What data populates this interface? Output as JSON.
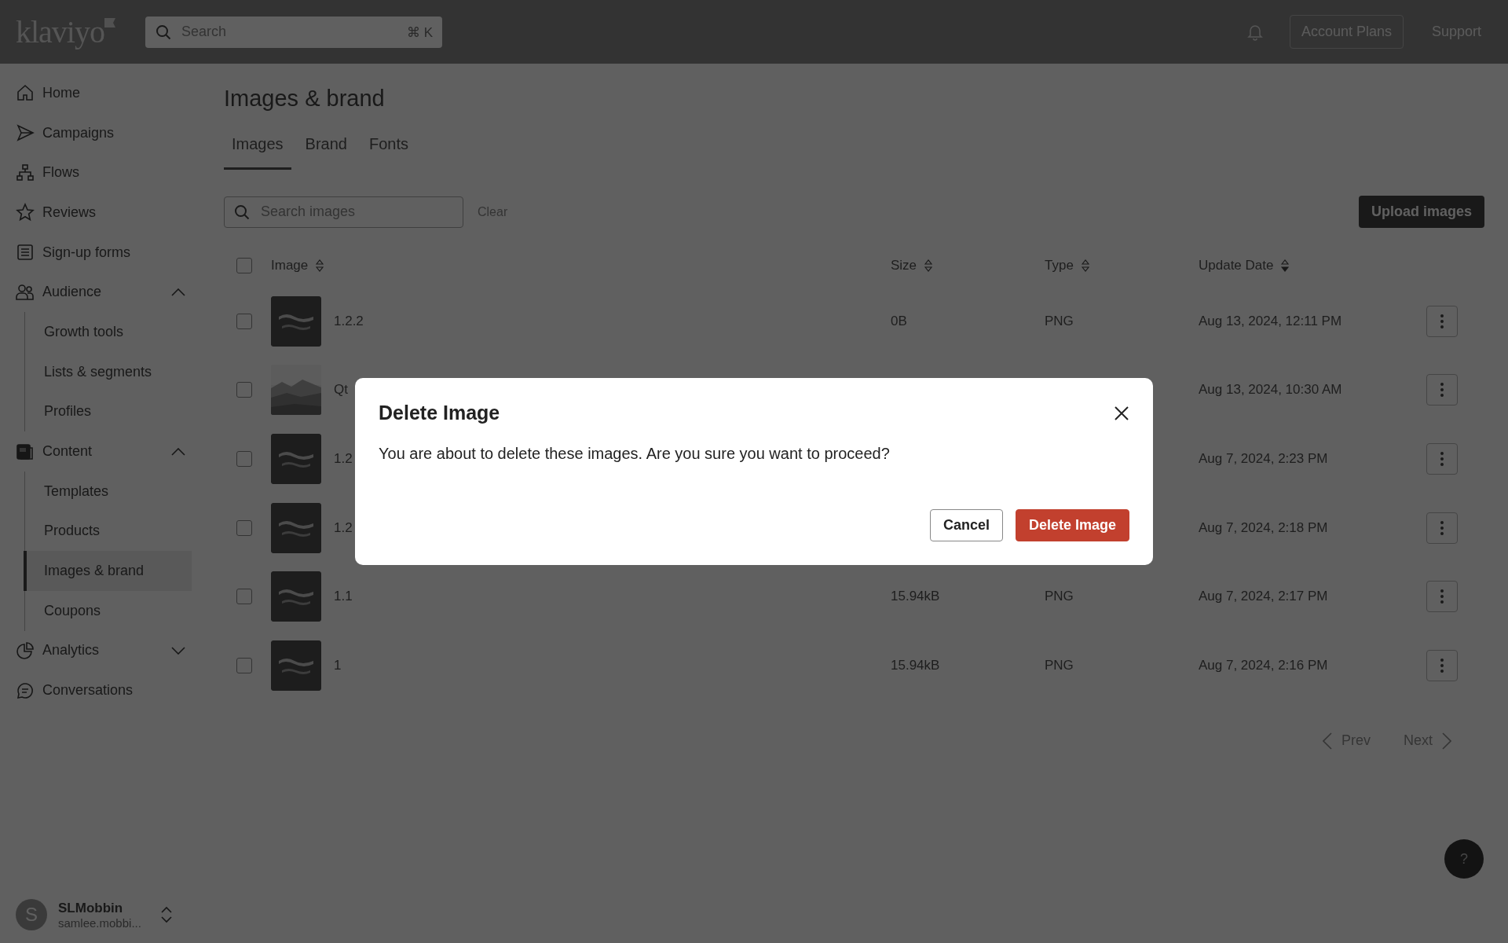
{
  "topbar": {
    "logo": "klaviyo",
    "search": {
      "placeholder": "Search",
      "shortcut": "⌘ K"
    },
    "buttons": [
      "Account Plans",
      "Support"
    ]
  },
  "sidebar": {
    "items": [
      {
        "label": "Home",
        "selected": false
      },
      {
        "label": "Campaigns",
        "selected": false
      },
      {
        "label": "Flows",
        "selected": false
      },
      {
        "label": "Reviews",
        "selected": false
      },
      {
        "label": "Sign-up forms",
        "selected": false
      },
      {
        "label": "Audience",
        "selected": false,
        "expanded": true,
        "children": [
          {
            "label": "Growth tools",
            "selected": false
          },
          {
            "label": "Lists & segments",
            "selected": false
          },
          {
            "label": "Profiles",
            "selected": false
          }
        ]
      },
      {
        "label": "Content",
        "selected": false,
        "expanded": true,
        "children": [
          {
            "label": "Templates",
            "selected": false
          },
          {
            "label": "Products",
            "selected": false
          },
          {
            "label": "Images & brand",
            "selected": true
          },
          {
            "label": "Coupons",
            "selected": false
          }
        ]
      },
      {
        "label": "Analytics",
        "selected": false,
        "expanded": false
      },
      {
        "label": "Conversations",
        "selected": false
      }
    ],
    "user": {
      "initial": "S",
      "name": "SLMobbin",
      "email": "samlee.mobbi..."
    }
  },
  "page": {
    "title": "Images & brand",
    "tabs": [
      {
        "label": "Images",
        "selected": true
      },
      {
        "label": "Brand",
        "selected": false
      },
      {
        "label": "Fonts",
        "selected": false
      }
    ],
    "search": {
      "placeholder": "Search images"
    },
    "clear": "Clear",
    "upload": "Upload images"
  },
  "table": {
    "select_all": {
      "checked": false
    },
    "columns": [
      {
        "label": "Image",
        "sorted": false
      },
      {
        "label": "Size",
        "sorted": false
      },
      {
        "label": "Type",
        "sorted": false
      },
      {
        "label": "Update Date",
        "sorted": true
      }
    ],
    "rows": [
      {
        "checked": false,
        "name": "1.2.2",
        "size": "0B",
        "type": "PNG",
        "date": "Aug 13, 2024, 12:11 PM"
      },
      {
        "checked": false,
        "name": "Qt",
        "date": "Aug 13, 2024, 10:30 AM"
      },
      {
        "checked": false,
        "name": "1.2",
        "date": "Aug 7, 2024, 2:23 PM"
      },
      {
        "checked": false,
        "name": "1.2",
        "date": "Aug 7, 2024, 2:18 PM"
      },
      {
        "checked": false,
        "name": "1.1",
        "size": "15.94kB",
        "type": "PNG",
        "date": "Aug 7, 2024, 2:17 PM"
      },
      {
        "checked": false,
        "name": "1",
        "size": "15.94kB",
        "type": "PNG",
        "date": "Aug 7, 2024, 2:16 PM"
      }
    ]
  },
  "pagination": [
    {
      "label": "Prev",
      "disabled": true
    },
    {
      "label": "Next",
      "disabled": true
    }
  ],
  "help": "?",
  "modal": {
    "title": "Delete Image",
    "message": "You are about to delete these images. Are you sure you want to proceed?",
    "buttons": [
      {
        "label": "Cancel",
        "kind": "secondary"
      },
      {
        "label": "Delete Image",
        "kind": "danger"
      }
    ]
  }
}
